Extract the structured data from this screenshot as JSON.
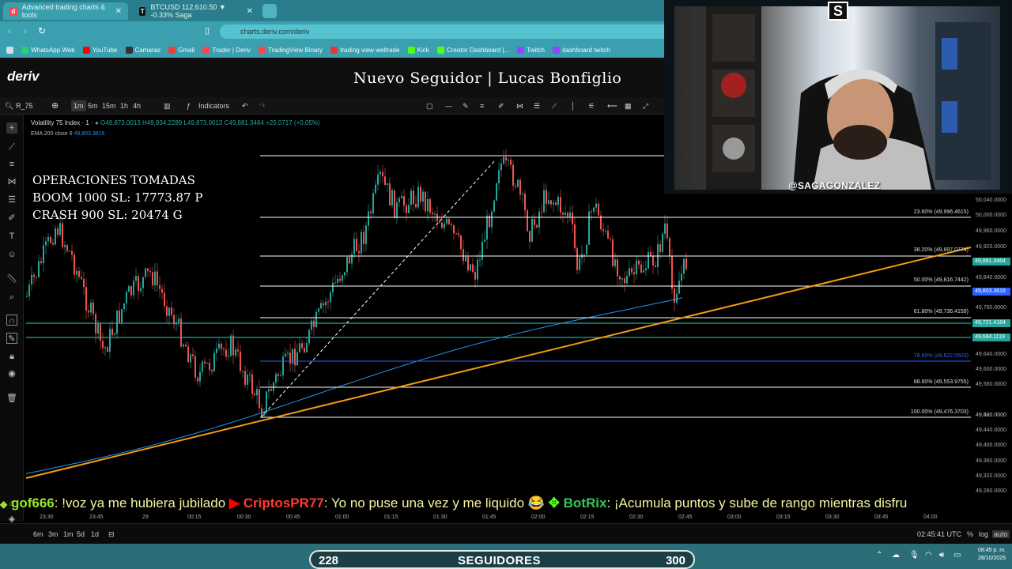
{
  "browser": {
    "tabs": [
      {
        "label": "Advanced trading charts & tools",
        "active": true
      },
      {
        "label": "BTCUSD 112,610.50 ▼ -0.33% Saga",
        "active": false
      }
    ],
    "url": "charts.deriv.com/deriv",
    "bookmarks": [
      "WhatsApp Web",
      "YouTube",
      "Camaras",
      "Gmail",
      "Trader | Deriv",
      "TradingView Binary",
      "trading view weltrade",
      "Kick",
      "Creator Dashboard |...",
      "Twitch",
      "dashboard twitch"
    ]
  },
  "header": {
    "logo": "deriv",
    "banner": "Nuevo Seguidor | Lucas Bonfiglio"
  },
  "toolbar": {
    "symbol": "R_75",
    "timeframes": [
      "1m",
      "5m",
      "15m",
      "1h",
      "4h"
    ],
    "indicators_label": "Indicators"
  },
  "chart_info": {
    "title": "Volatility 75 Index · 1 ·",
    "ohlc": "O49,873.0013 H49,934.2289 L49,873.0013 C49,881.3464 +25.0717 (+0.05%)",
    "ema_label": "EMA 200 close 0",
    "ema_value": "49,803.3616"
  },
  "overlay": {
    "line1": "OPERACIONES TOMADAS",
    "line2": "BOOM 1000 SL: 17773.87 P",
    "line3": "CRASH 900 SL:  20474 G"
  },
  "fib_levels": [
    {
      "label": "23.60% (49,996.4615)",
      "color": "#ffffff"
    },
    {
      "label": "38.20% (49,897.0774)",
      "color": "#ffffff"
    },
    {
      "label": "50.00% (49,816.7442)",
      "color": "#ffffff"
    },
    {
      "label": "61.80% (49,736.4159)",
      "color": "#ffffff"
    },
    {
      "label": "78.60% (49,622.0503)",
      "color": "#2962ff"
    },
    {
      "label": "88.60% (49,553.9755)",
      "color": "#ffffff"
    },
    {
      "label": "100.00% (49,476.3703)",
      "color": "#ffffff"
    }
  ],
  "price_axis": [
    "50,040.0000",
    "50,000.0000",
    "49,960.0000",
    "49,920.0000",
    "49,840.0000",
    "49,760.0000",
    "49,640.0000",
    "49,600.0000",
    "49,560.0000",
    "49,520.0000",
    "49,480.0000",
    "49,440.0000",
    "49,400.0000",
    "49,360.0000",
    "49,320.0000",
    "49,280.0000"
  ],
  "price_tags": [
    {
      "label": "49,881.3464",
      "color": "#26a69a"
    },
    {
      "label": "49,803.3616",
      "color": "#2962ff"
    },
    {
      "label": "49,721.4184",
      "color": "#26a69a"
    },
    {
      "label": "49,684.1119",
      "color": "#26a69a"
    }
  ],
  "time_axis": [
    "23:30",
    "23:45",
    "29",
    "00:15",
    "00:30",
    "00:45",
    "01:00",
    "01:15",
    "01:30",
    "01:45",
    "02:00",
    "02:15",
    "02:30",
    "02:45",
    "03:00",
    "03:15",
    "03:30",
    "03:45",
    "04:00"
  ],
  "bottom_bar": {
    "ranges": [
      "6m",
      "3m",
      "1m",
      "5d",
      "1d"
    ],
    "time": "02:45:41 UTC",
    "percent": "%",
    "log": "log",
    "auto": "auto"
  },
  "chat": [
    {
      "user": "gof666",
      "message": ": !voz ya me hubiera jubilado"
    },
    {
      "user": "CriptosPR77",
      "message": ": Yo no puse una vez y me liquido 😂"
    },
    {
      "user": "BotRix",
      "message": ": ¡Acumula puntos y sube de rango mientras disfru"
    }
  ],
  "followers_bar": {
    "current": "228",
    "label": "SEGUIDORES",
    "goal": "300"
  },
  "system_clock": {
    "time": "08:45 p. m.",
    "date": "28/10/2025"
  },
  "webcam": {
    "handle": "@SAGAGONZALEZ",
    "logo": "S"
  }
}
